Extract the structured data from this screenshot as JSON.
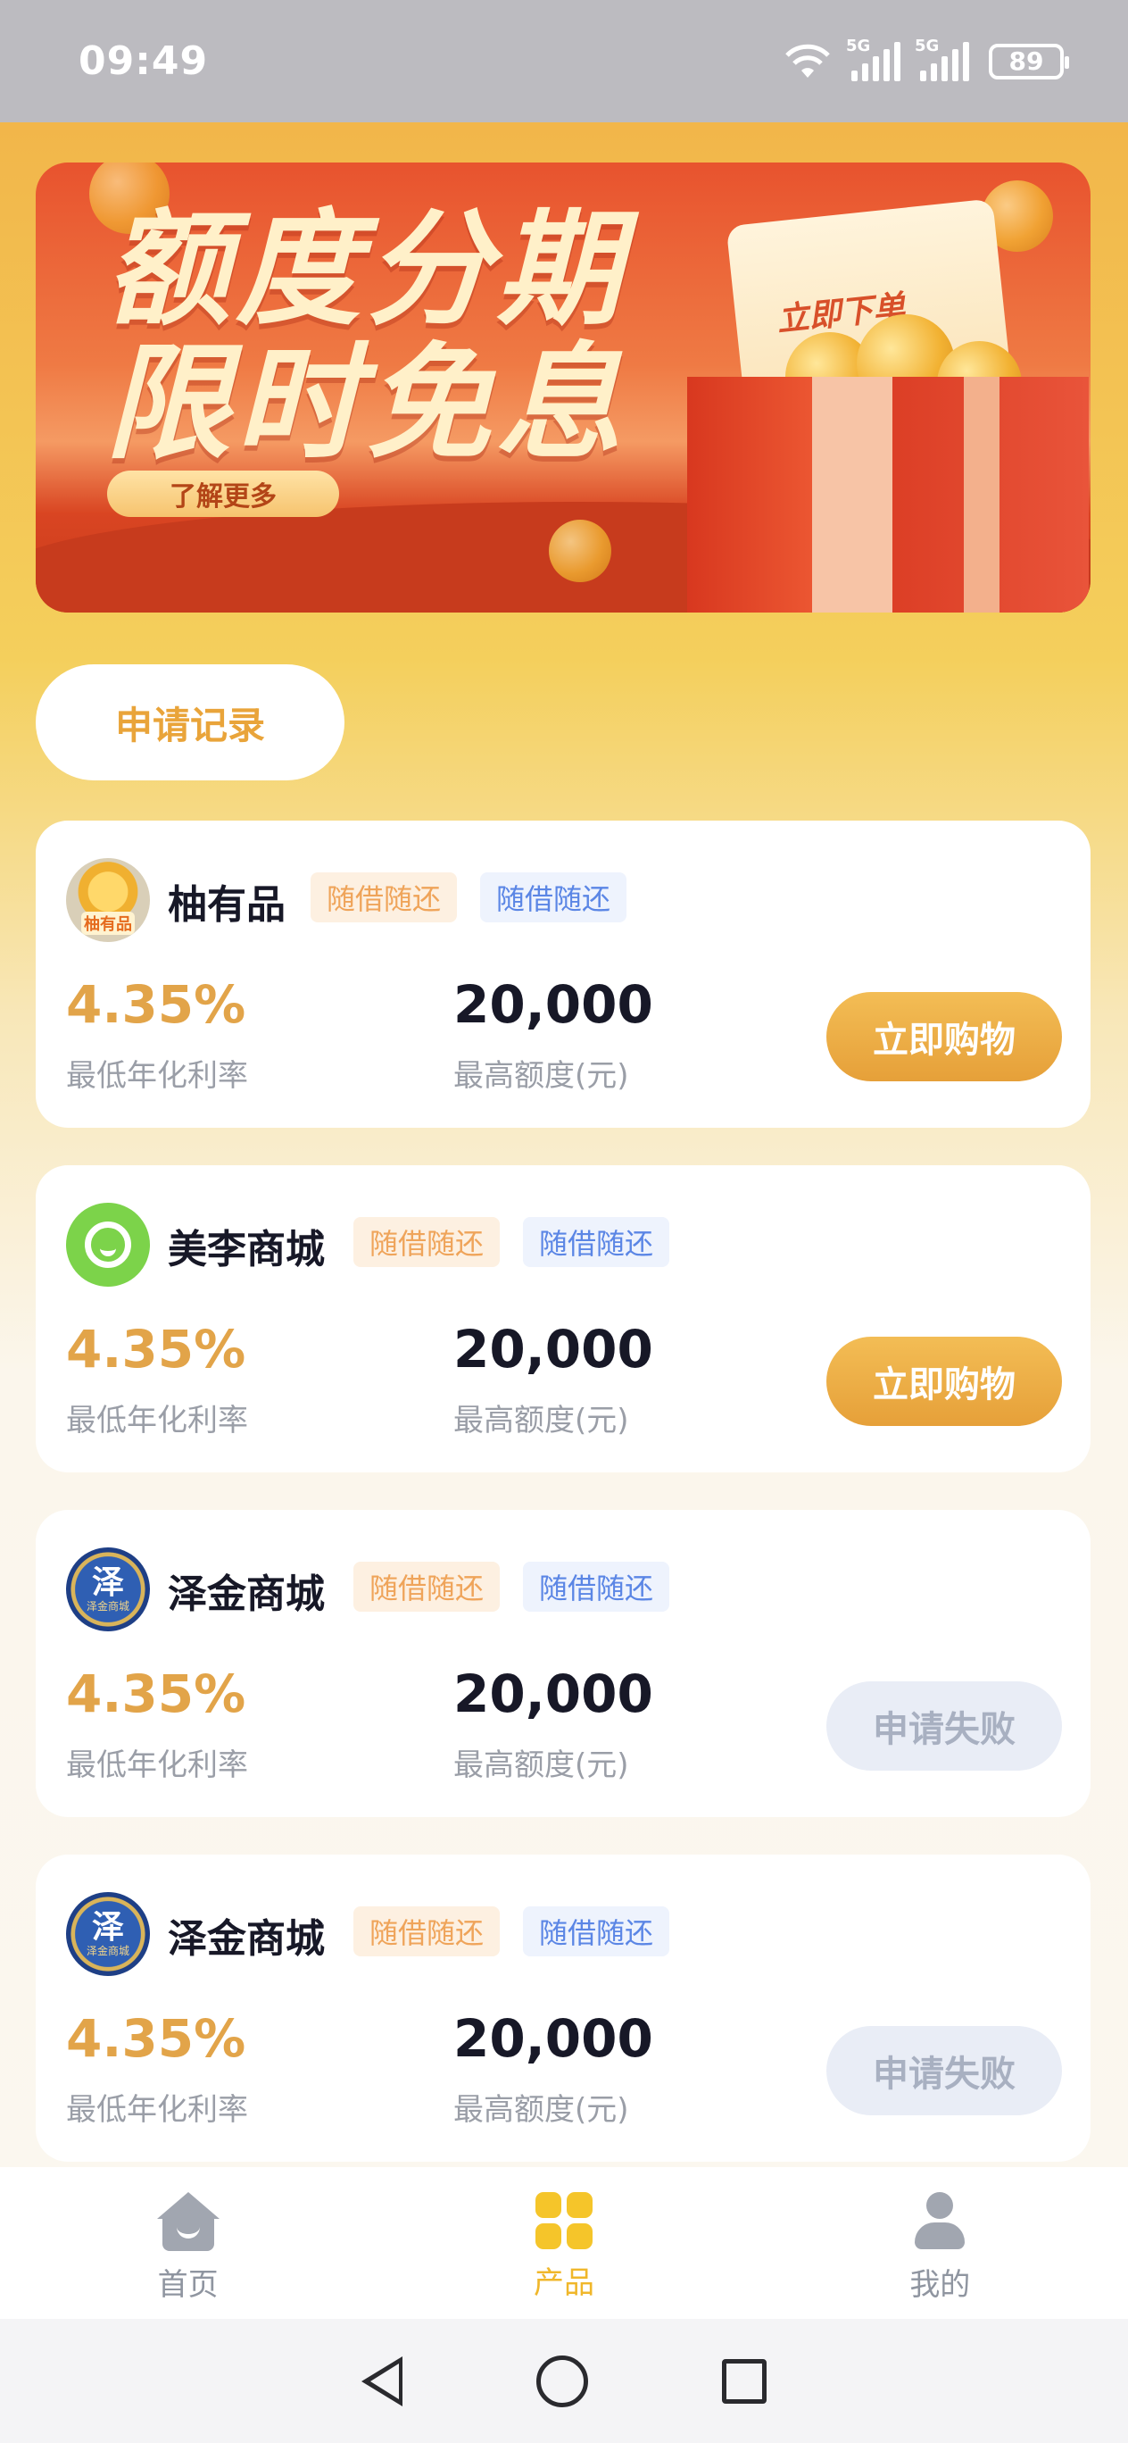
{
  "status_bar": {
    "time": "09:49",
    "network_label_1": "5G",
    "network_label_2": "5G",
    "battery": "89"
  },
  "banner": {
    "title_line1": "额度分期",
    "title_line2": "限时免息",
    "learn_more": "了解更多",
    "order_label": "立即下单"
  },
  "record_button": "申请记录",
  "products": [
    {
      "name": "柚有品",
      "logo_text": "柚有品",
      "tag1": "随借随还",
      "tag2": "随借随还",
      "rate": "4.35%",
      "rate_label": "最低年化利率",
      "amount": "20,000",
      "amount_label": "最高额度(元)",
      "action": "立即购物",
      "status": "active"
    },
    {
      "name": "美李商城",
      "tag1": "随借随还",
      "tag2": "随借随还",
      "rate": "4.35%",
      "rate_label": "最低年化利率",
      "amount": "20,000",
      "amount_label": "最高额度(元)",
      "action": "立即购物",
      "status": "active"
    },
    {
      "name": "泽金商城",
      "logo_text": "泽",
      "logo_sub": "泽金商城",
      "tag1": "随借随还",
      "tag2": "随借随还",
      "rate": "4.35%",
      "rate_label": "最低年化利率",
      "amount": "20,000",
      "amount_label": "最高额度(元)",
      "action": "申请失败",
      "status": "failed"
    },
    {
      "name": "泽金商城",
      "logo_text": "泽",
      "logo_sub": "泽金商城",
      "tag1": "随借随还",
      "tag2": "随借随还",
      "rate": "4.35%",
      "rate_label": "最低年化利率",
      "amount": "20,000",
      "amount_label": "最高额度(元)",
      "action": "申请失败",
      "status": "failed"
    }
  ],
  "tab_bar": {
    "home": "首页",
    "products": "产品",
    "me": "我的",
    "active": "products"
  },
  "colors": {
    "accent": "#f0b72b",
    "rate": "#e2a449",
    "button_active": "#e6a039",
    "button_failed": "#e9edf6"
  }
}
